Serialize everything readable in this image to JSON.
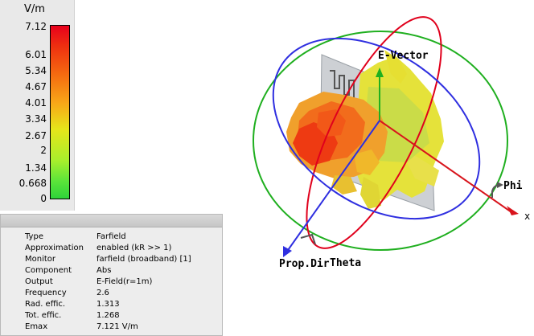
{
  "colorbar": {
    "unit": "V/m",
    "ticks": [
      "7.12",
      "6.01",
      "5.34",
      "4.67",
      "4.01",
      "3.34",
      "2.67",
      "2",
      "1.34",
      "0.668",
      "0"
    ],
    "max_color": "#e8001c",
    "min_color": "#2ed33a"
  },
  "info": {
    "rows": [
      {
        "key": "Type",
        "value": "Farfield"
      },
      {
        "key": "Approximation",
        "value": "enabled (kR >> 1)"
      },
      {
        "key": "Monitor",
        "value": "farfield (broadband) [1]"
      },
      {
        "key": "Component",
        "value": "Abs"
      },
      {
        "key": "Output",
        "value": "E-Field(r=1m)"
      },
      {
        "key": "Frequency",
        "value": "2.6"
      },
      {
        "key": "Rad. effic.",
        "value": "1.313"
      },
      {
        "key": "Tot. effic.",
        "value": "1.268"
      },
      {
        "key": "Emax",
        "value": "7.121 V/m"
      }
    ]
  },
  "axes": {
    "e_vector": "E-Vector",
    "phi": "Phi",
    "x": "x",
    "prop_direction": "Prop.Dir",
    "theta": "Theta"
  },
  "colors": {
    "phi_circle": "#1faf1f",
    "theta_circle": "#2f2fe0",
    "red_circle": "#e0001c",
    "x_axis": "#d8141c",
    "z_axis": "#1fb01f"
  }
}
